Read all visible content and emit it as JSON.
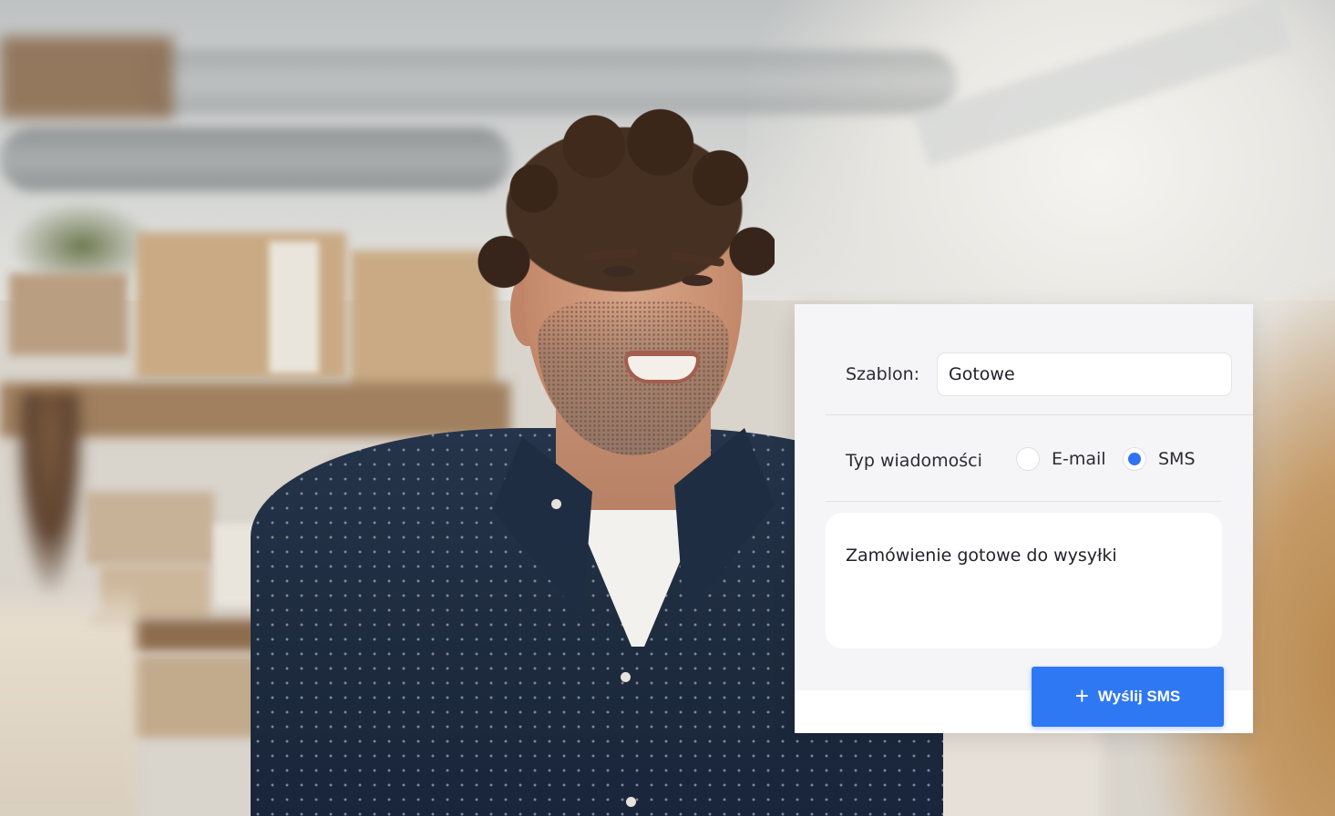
{
  "form": {
    "template_label": "Szablon:",
    "template_value": "Gotowe",
    "message_type_label": "Typ wiadomości",
    "options": [
      {
        "label": "E-mail",
        "checked": false
      },
      {
        "label": "SMS",
        "checked": true
      }
    ],
    "message_text": "Zamówienie gotowe do wysyłki",
    "send_button_label": "Wyślij SMS",
    "send_button_icon": "plus-icon"
  },
  "colors": {
    "accent": "#2f78f3",
    "card_bg": "#f5f5f7",
    "text": "#2b2b33"
  }
}
